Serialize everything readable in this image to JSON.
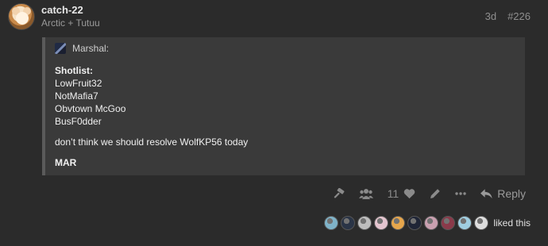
{
  "post": {
    "username": "catch-22",
    "user_title": "Arctic + Tutuu",
    "age": "3d",
    "post_number": "#226"
  },
  "quote": {
    "author": "Marshal:",
    "heading": "Shotlist:",
    "list": [
      "LowFruit32",
      "NotMafia7",
      "Obvtown McGoo",
      "BusF0dder"
    ],
    "message": "don’t think we should resolve WolfKP56 today",
    "signature": "MAR"
  },
  "actions": {
    "like_count": "11",
    "reply_label": "Reply"
  },
  "likers": {
    "text": "liked this",
    "avatar_colors": [
      "#7fb3c9",
      "#2a3446",
      "#bdbdbd",
      "#e4c5cf",
      "#e6a64c",
      "#1f2536",
      "#c9a0b0",
      "#8a3a4a",
      "#9fcde0",
      "#dedede"
    ]
  },
  "colors": {
    "background": "#2b2b2b",
    "quote_background": "#3a3a3a",
    "muted": "#8a8a8a"
  }
}
